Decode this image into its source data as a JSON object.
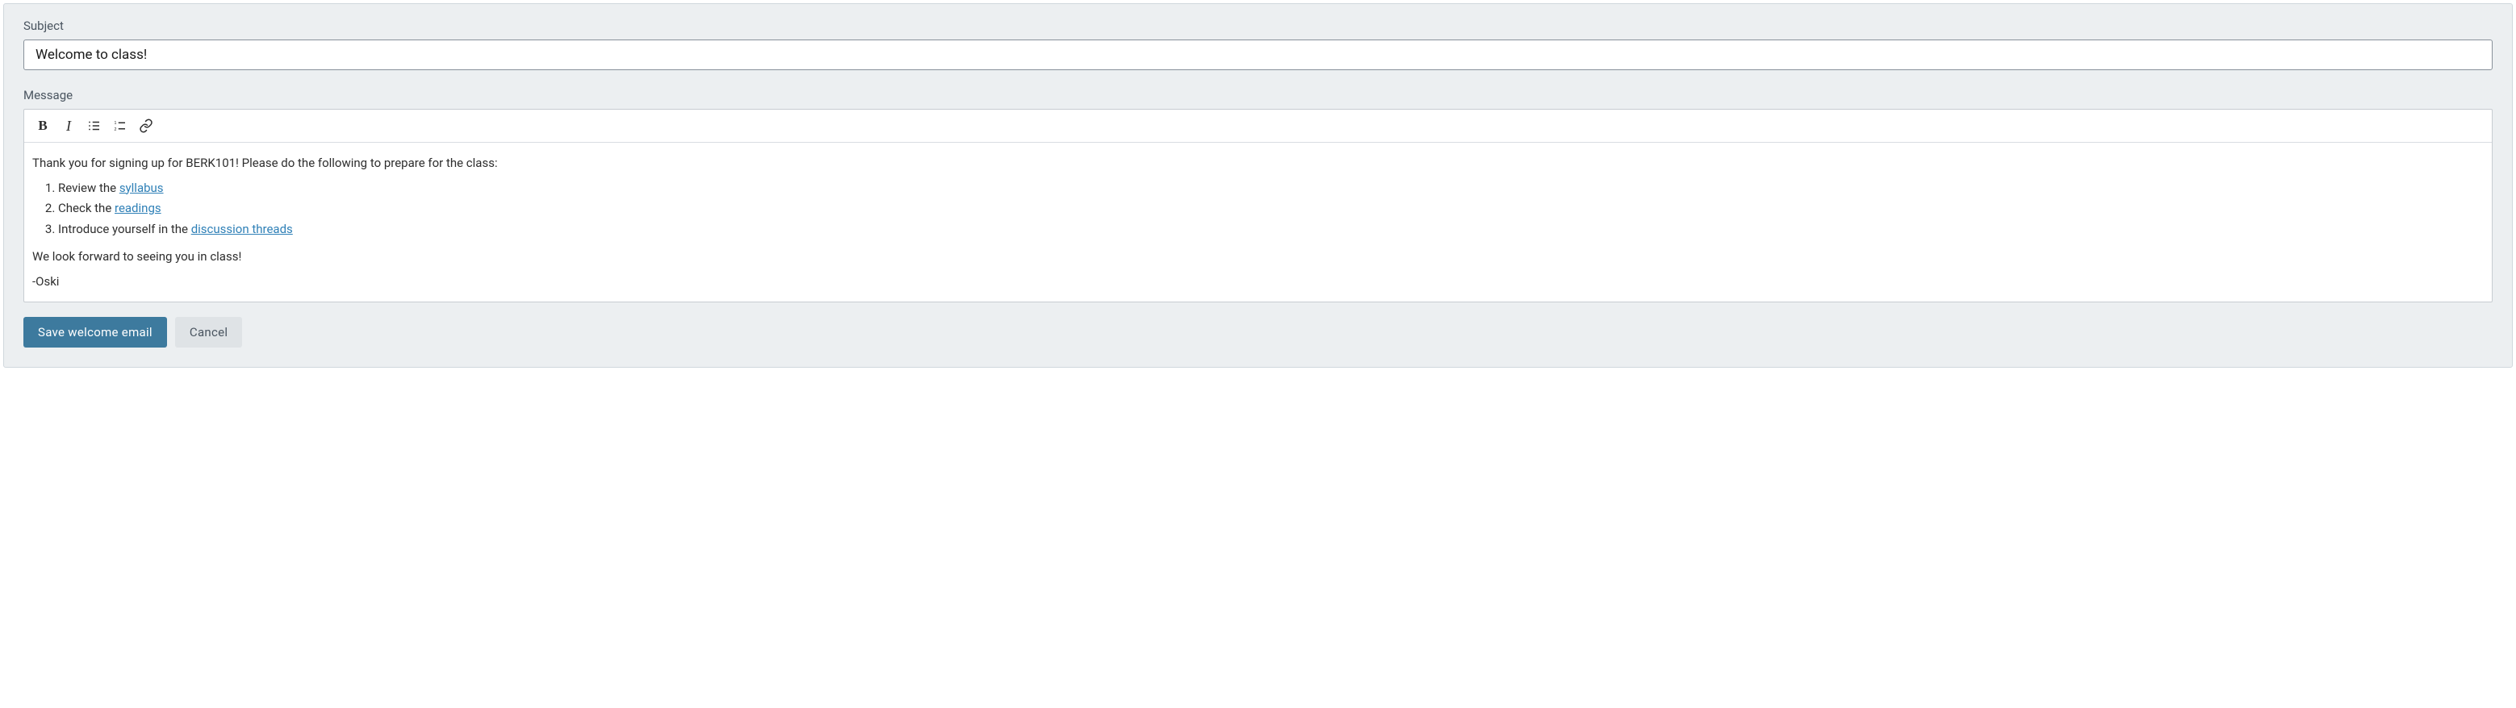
{
  "subject": {
    "label": "Subject",
    "value": "Welcome to class!"
  },
  "message": {
    "label": "Message",
    "intro": "Thank you for signing up for BERK101! Please do the following to prepare for the class:",
    "items": [
      {
        "prefix": "Review the ",
        "link_text": "syllabus"
      },
      {
        "prefix": "Check the ",
        "link_text": "readings"
      },
      {
        "prefix": "Introduce yourself in the ",
        "link_text": "discussion threads"
      }
    ],
    "closing": "We look forward to seeing you in class!",
    "signature": "-Oski"
  },
  "toolbar": {
    "bold": "B",
    "italic": "I"
  },
  "buttons": {
    "save": "Save welcome email",
    "cancel": "Cancel"
  }
}
